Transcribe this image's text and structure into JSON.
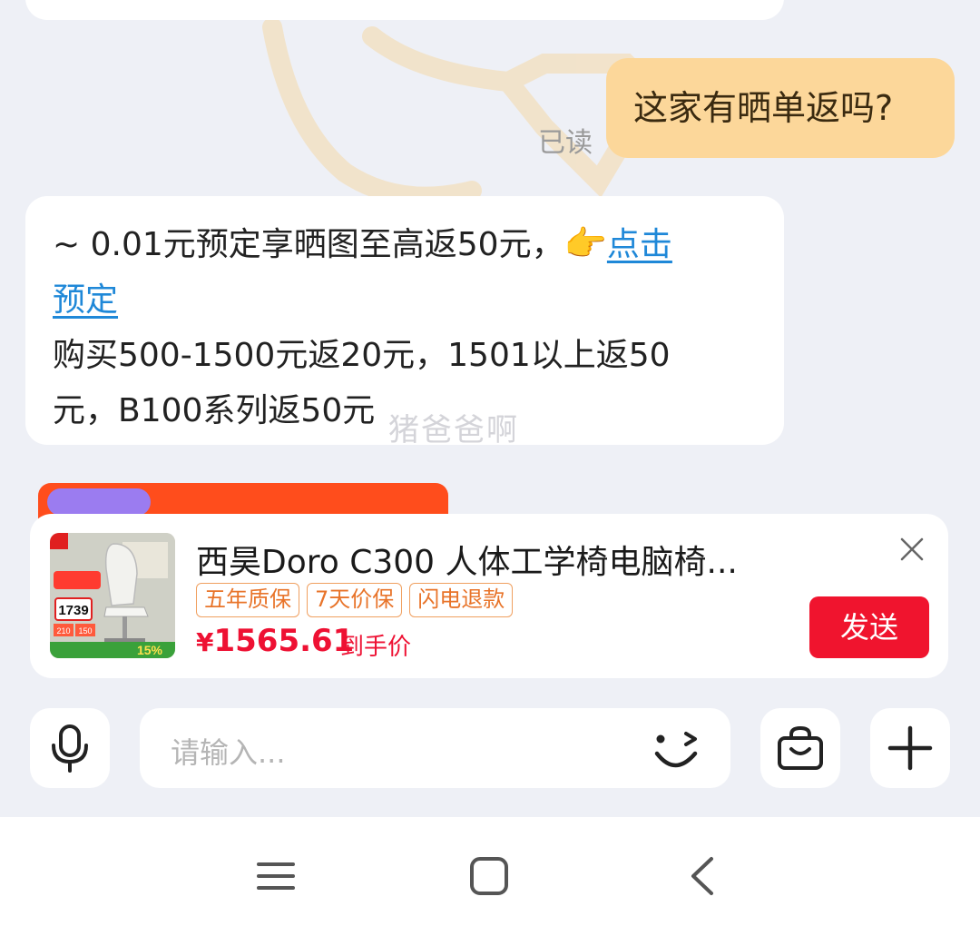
{
  "chat": {
    "outgoing_message": "这家有晒单返吗?",
    "read_status": "已读",
    "incoming": {
      "line1_text": "~ 0.01元预定享晒图至高返50元，",
      "emoji": "👉",
      "link_part1": "点击",
      "link_part2": "预定",
      "line3": "购买500-1500元返20元，1501以上返50",
      "line4": "元，B100系列返50元"
    },
    "watermark": "猪爸爸啊"
  },
  "product_card": {
    "title": "西昊Doro C300 人体工学椅电脑椅...",
    "tags": [
      "五年质保",
      "7天价保",
      "闪电退款"
    ],
    "price_symbol": "¥",
    "price_value": "1565.61",
    "price_label": "到手价",
    "send_label": "发送",
    "image_price_badge": "1739",
    "image_discount_text": "15%",
    "image_badge_210": "210",
    "image_badge_150": "150",
    "icons": {
      "close": "close-icon"
    }
  },
  "input_bar": {
    "placeholder": "请输入...",
    "icons": {
      "mic": "microphone-icon",
      "emoji": "emoji-wink-icon",
      "bag": "shopping-bag-icon",
      "plus": "plus-icon"
    }
  },
  "nav_bar": {
    "icons": [
      "menu-icon",
      "home-square-icon",
      "back-chevron-icon"
    ]
  },
  "colors": {
    "background": "#eef0f6",
    "outgoing_bubble": "#fcd79a",
    "link": "#1f88d8",
    "price_red": "#ee1133",
    "send_button": "#f0142e",
    "tag_orange": "#e8742a"
  }
}
